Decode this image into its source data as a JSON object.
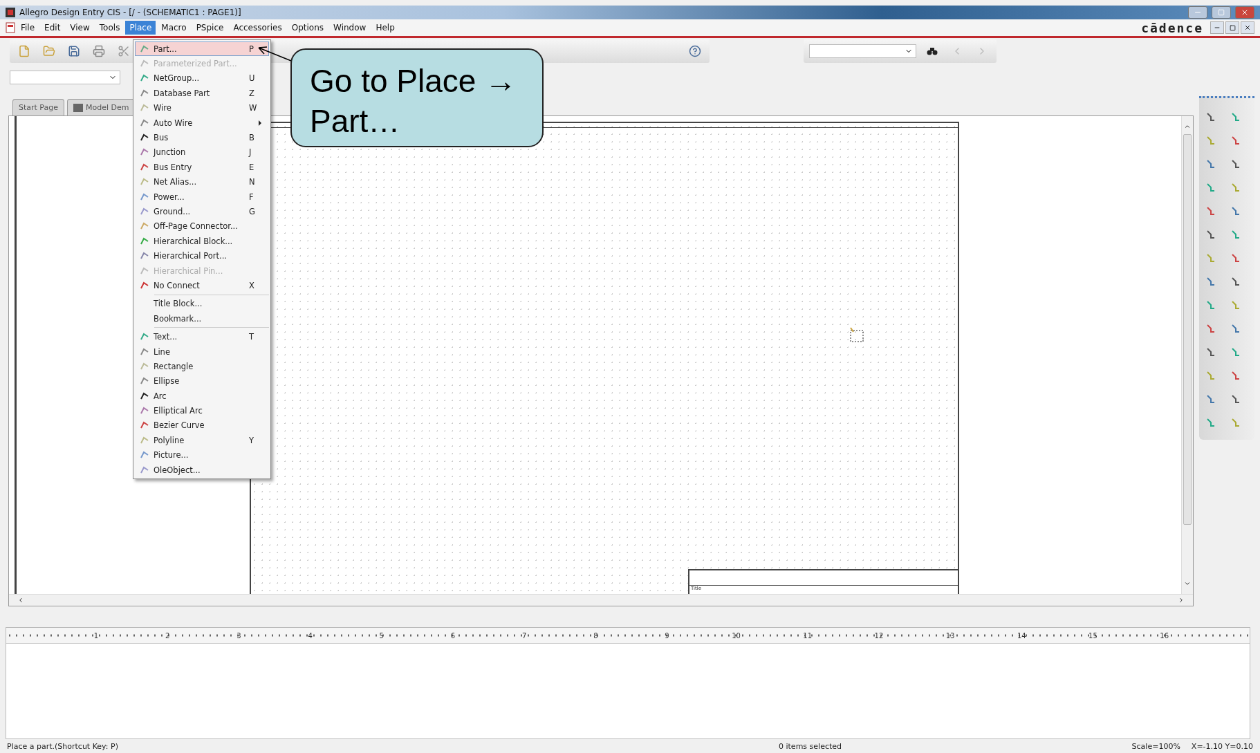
{
  "window": {
    "title": "Allegro Design Entry CIS - [/ - (SCHEMATIC1 : PAGE1)]",
    "logo": "cādence"
  },
  "menu_bar": [
    {
      "label": "File",
      "selected": false
    },
    {
      "label": "Edit",
      "selected": false
    },
    {
      "label": "View",
      "selected": false
    },
    {
      "label": "Tools",
      "selected": false
    },
    {
      "label": "Place",
      "selected": true
    },
    {
      "label": "Macro",
      "selected": false
    },
    {
      "label": "PSpice",
      "selected": false
    },
    {
      "label": "Accessories",
      "selected": false
    },
    {
      "label": "Options",
      "selected": false
    },
    {
      "label": "Window",
      "selected": false
    },
    {
      "label": "Help",
      "selected": false
    }
  ],
  "place_menu": [
    {
      "kind": "item",
      "label": "Part...",
      "shortcut": "P",
      "selected": true,
      "disabled": false
    },
    {
      "kind": "item",
      "label": "Parameterized Part...",
      "selected": false,
      "disabled": true
    },
    {
      "kind": "item",
      "label": "NetGroup...",
      "shortcut": "U",
      "selected": false,
      "disabled": false
    },
    {
      "kind": "item",
      "label": "Database Part",
      "shortcut": "Z",
      "selected": false,
      "disabled": false
    },
    {
      "kind": "item",
      "label": "Wire",
      "shortcut": "W",
      "selected": false,
      "disabled": false
    },
    {
      "kind": "submenu",
      "label": "Auto Wire",
      "selected": false,
      "disabled": false
    },
    {
      "kind": "item",
      "label": "Bus",
      "shortcut": "B",
      "selected": false,
      "disabled": false
    },
    {
      "kind": "item",
      "label": "Junction",
      "shortcut": "J",
      "selected": false,
      "disabled": false
    },
    {
      "kind": "item",
      "label": "Bus Entry",
      "shortcut": "E",
      "selected": false,
      "disabled": false
    },
    {
      "kind": "item",
      "label": "Net Alias...",
      "shortcut": "N",
      "selected": false,
      "disabled": false
    },
    {
      "kind": "item",
      "label": "Power...",
      "shortcut": "F",
      "selected": false,
      "disabled": false
    },
    {
      "kind": "item",
      "label": "Ground...",
      "shortcut": "G",
      "selected": false,
      "disabled": false
    },
    {
      "kind": "item",
      "label": "Off-Page Connector...",
      "selected": false,
      "disabled": false
    },
    {
      "kind": "item",
      "label": "Hierarchical Block...",
      "selected": false,
      "disabled": false
    },
    {
      "kind": "item",
      "label": "Hierarchical Port...",
      "selected": false,
      "disabled": false
    },
    {
      "kind": "item",
      "label": "Hierarchical Pin...",
      "selected": false,
      "disabled": true
    },
    {
      "kind": "item",
      "label": "No Connect",
      "shortcut": "X",
      "selected": false,
      "disabled": false
    },
    {
      "kind": "separator"
    },
    {
      "kind": "item",
      "label": "Title Block...",
      "selected": false,
      "disabled": false
    },
    {
      "kind": "item",
      "label": "Bookmark...",
      "selected": false,
      "disabled": false
    },
    {
      "kind": "separator"
    },
    {
      "kind": "item",
      "label": "Text...",
      "shortcut": "T",
      "selected": false,
      "disabled": false
    },
    {
      "kind": "item",
      "label": "Line",
      "selected": false,
      "disabled": false
    },
    {
      "kind": "item",
      "label": "Rectangle",
      "selected": false,
      "disabled": false
    },
    {
      "kind": "item",
      "label": "Ellipse",
      "selected": false,
      "disabled": false
    },
    {
      "kind": "item",
      "label": "Arc",
      "selected": false,
      "disabled": false
    },
    {
      "kind": "item",
      "label": "Elliptical Arc",
      "selected": false,
      "disabled": false
    },
    {
      "kind": "item",
      "label": "Bezier Curve",
      "selected": false,
      "disabled": false
    },
    {
      "kind": "item",
      "label": "Polyline",
      "shortcut": "Y",
      "selected": false,
      "disabled": false
    },
    {
      "kind": "item",
      "label": "Picture...",
      "selected": false,
      "disabled": false
    },
    {
      "kind": "item",
      "label": "OleObject...",
      "selected": false,
      "disabled": false
    }
  ],
  "tabs": [
    {
      "label": "Start Page",
      "selected": false
    },
    {
      "label": "Model Dem",
      "selected": false
    }
  ],
  "page": {
    "title_block_label": "Title"
  },
  "callout": {
    "text": "Go to Place → Part…"
  },
  "ruler": [
    "1",
    "2",
    "3",
    "4",
    "5",
    "6",
    "7",
    "8",
    "9",
    "10",
    "11",
    "12",
    "13",
    "14",
    "15",
    "16"
  ],
  "status_bar": {
    "message": "Place a part.(Shortcut Key: P)",
    "selection": "0 items selected",
    "scale": "Scale=100%",
    "coords": "X=-1.10  Y=0.10"
  }
}
